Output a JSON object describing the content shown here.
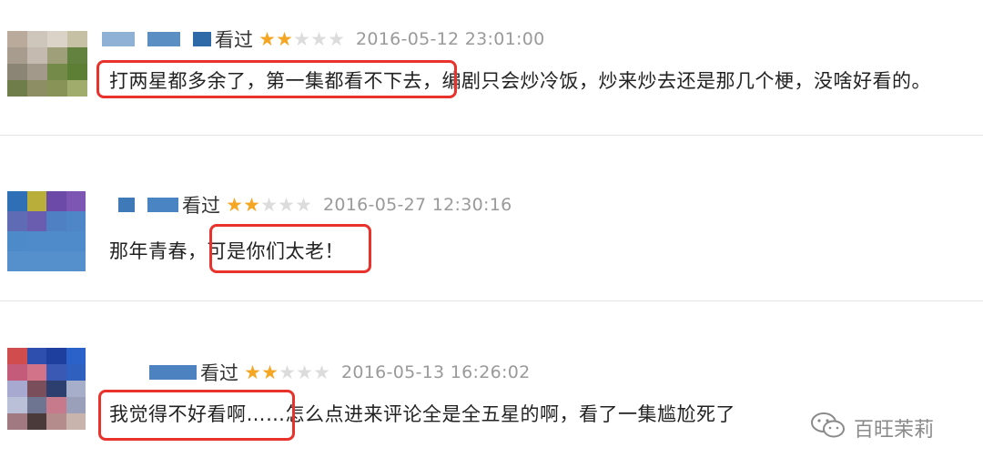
{
  "reviews": [
    {
      "status": "看过",
      "rating": 2,
      "max_rating": 5,
      "date": "2016-05-12 23:01:00",
      "comment_highlight": "打两星都多余了，第一集都看不下去，",
      "comment_rest": "编剧只会炒冷饭，炒来炒去还是那几个梗，没啥好看的。"
    },
    {
      "status": "看过",
      "rating": 2,
      "max_rating": 5,
      "date": "2016-05-27 12:30:16",
      "comment_prefix": "那年青春，",
      "comment_highlight": "可是你们太老！"
    },
    {
      "status": "看过",
      "rating": 2,
      "max_rating": 5,
      "date": "2016-05-13 16:26:02",
      "comment_highlight": "我觉得不好看啊……",
      "comment_rest": "怎么点进来评论全是全五星的啊，看了一集尴尬死了"
    }
  ],
  "watermark": {
    "text": "百旺茉莉",
    "icon": "wechat-icon"
  },
  "colors": {
    "highlight": "#e8322b",
    "star_on": "#f5a623",
    "star_off": "#dcdcdc",
    "date": "#9a9a9a"
  }
}
